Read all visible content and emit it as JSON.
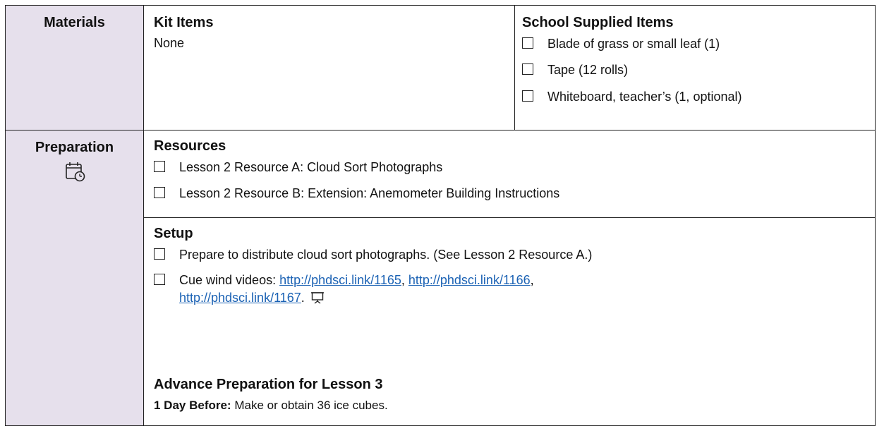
{
  "materials": {
    "label": "Materials",
    "kit": {
      "heading": "Kit Items",
      "body": "None"
    },
    "school": {
      "heading": "School Supplied Items",
      "items": [
        "Blade of grass or small leaf (1)",
        "Tape (12 rolls)",
        "Whiteboard, teacher’s (1, optional)"
      ]
    }
  },
  "preparation": {
    "label": "Preparation",
    "icon": "calendar-clock-icon",
    "resources": {
      "heading": "Resources",
      "items": [
        "Lesson 2 Resource A: Cloud Sort Photographs",
        "Lesson 2 Resource B: Extension: Anemometer Building Instructions"
      ]
    },
    "setup": {
      "heading": "Setup",
      "item1": "Prepare to distribute cloud sort photographs. (See Lesson 2 Resource A.)",
      "item2_prefix": "Cue wind videos: ",
      "links": [
        "http://phdsci.link/1165",
        "http://phdsci.link/1166",
        "http://phdsci.link/1167"
      ],
      "sep": ", ",
      "end": ".",
      "presenter_icon": "presentation-screen-icon"
    },
    "advance": {
      "heading": "Advance Preparation for Lesson 3",
      "lead": "1 Day Before:",
      "text": " Make or obtain 36 ice cubes."
    }
  },
  "colors": {
    "label_bg": "#e6e0ec",
    "link": "#1b62b4",
    "border": "#222222"
  }
}
